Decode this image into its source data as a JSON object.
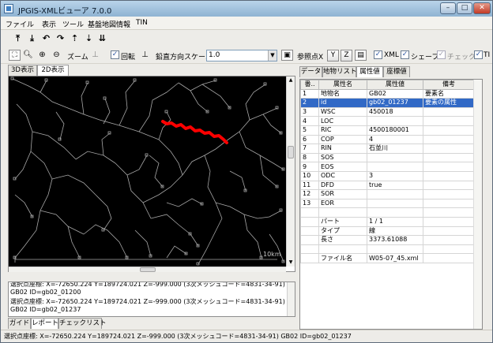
{
  "window": {
    "title": "JPGIS-XMLビューア 7.0.0",
    "min_label": "–",
    "max_label": "□",
    "close_label": "✕"
  },
  "menu": [
    "ファイル",
    "表示",
    "ツール",
    "基盤地図情報",
    "TIN"
  ],
  "toolbar1": {
    "icons": [
      "move-up-icon",
      "move-down-icon",
      "rotate-left-icon",
      "rotate-right-icon",
      "go-top-icon",
      "go-bottom-icon"
    ]
  },
  "toolbar2": {
    "zoom_label": "ズーム",
    "rotate_label": "回転",
    "rotate_checked": true,
    "vertical_scale_label": "鉛直方向スケール",
    "vertical_scale_value": "1.0",
    "ref_point_label": "参照点X",
    "y_label": "Y",
    "z_label": "Z",
    "xml_label": "XML",
    "xml_checked": true,
    "shape_label": "シェープ",
    "shape_checked": true,
    "check_label": "チェック",
    "check_checked": false,
    "tin_label": "TI"
  },
  "view_tabs": [
    "3D表示",
    "2D表示"
  ],
  "active_view_tab": 1,
  "map": {
    "scale_text": "10km",
    "river_color": "#ff0000",
    "line_color": "#a8a8a8",
    "background": "#000000"
  },
  "log": {
    "lines": [
      "選択点座標: X=-72650.224 Y=189724.021 Z=-999.000 (3次メッシュコード=4831-34-91)",
      "GB02 ID=gb02_01200",
      "選択点座標: X=-72650.224 Y=189724.021 Z=-999.000 (3次メッシュコード=4831-34-91)",
      "GB02 ID=gb02_01237"
    ]
  },
  "bottom_tabs": [
    "ガイド",
    "レポート",
    "チェックリスト"
  ],
  "active_bottom_tab": 1,
  "right_tabs": [
    "データ",
    "地物リスト",
    "属性値",
    "座標値"
  ],
  "active_right_tab": 2,
  "attributes": {
    "headers": [
      "番..",
      "属性名",
      "属性値",
      "備考"
    ],
    "rows": [
      [
        "1",
        "地物名",
        "GB02",
        "要素名"
      ],
      [
        "2",
        "id",
        "gb02_01237",
        "要素の属性"
      ],
      [
        "3",
        "WSC",
        "450018",
        ""
      ],
      [
        "4",
        "LOC",
        "",
        ""
      ],
      [
        "5",
        "RIC",
        "4500180001",
        ""
      ],
      [
        "6",
        "COP",
        "4",
        ""
      ],
      [
        "7",
        "RIN",
        "石並川",
        ""
      ],
      [
        "8",
        "SOS",
        "",
        ""
      ],
      [
        "9",
        "EOS",
        "",
        ""
      ],
      [
        "10",
        "ODC",
        "3",
        ""
      ],
      [
        "11",
        "DFD",
        "true",
        ""
      ],
      [
        "12",
        "SOR",
        "",
        ""
      ],
      [
        "13",
        "EOR",
        "",
        ""
      ],
      [
        "",
        "",
        "",
        ""
      ],
      [
        "",
        "パート",
        "1 / 1",
        ""
      ],
      [
        "",
        "タイプ",
        "線",
        ""
      ],
      [
        "",
        "長さ",
        "3373.61088",
        ""
      ],
      [
        "",
        "",
        "",
        ""
      ],
      [
        "",
        "ファイル名",
        "W05-07_45.xml",
        ""
      ]
    ],
    "selected_row": 1
  },
  "status": "選択点座標: X=-72650.224 Y=189724.021 Z=-999.000 (3次メッシュコード=4831-34-91) GB02 ID=gb02_01237"
}
